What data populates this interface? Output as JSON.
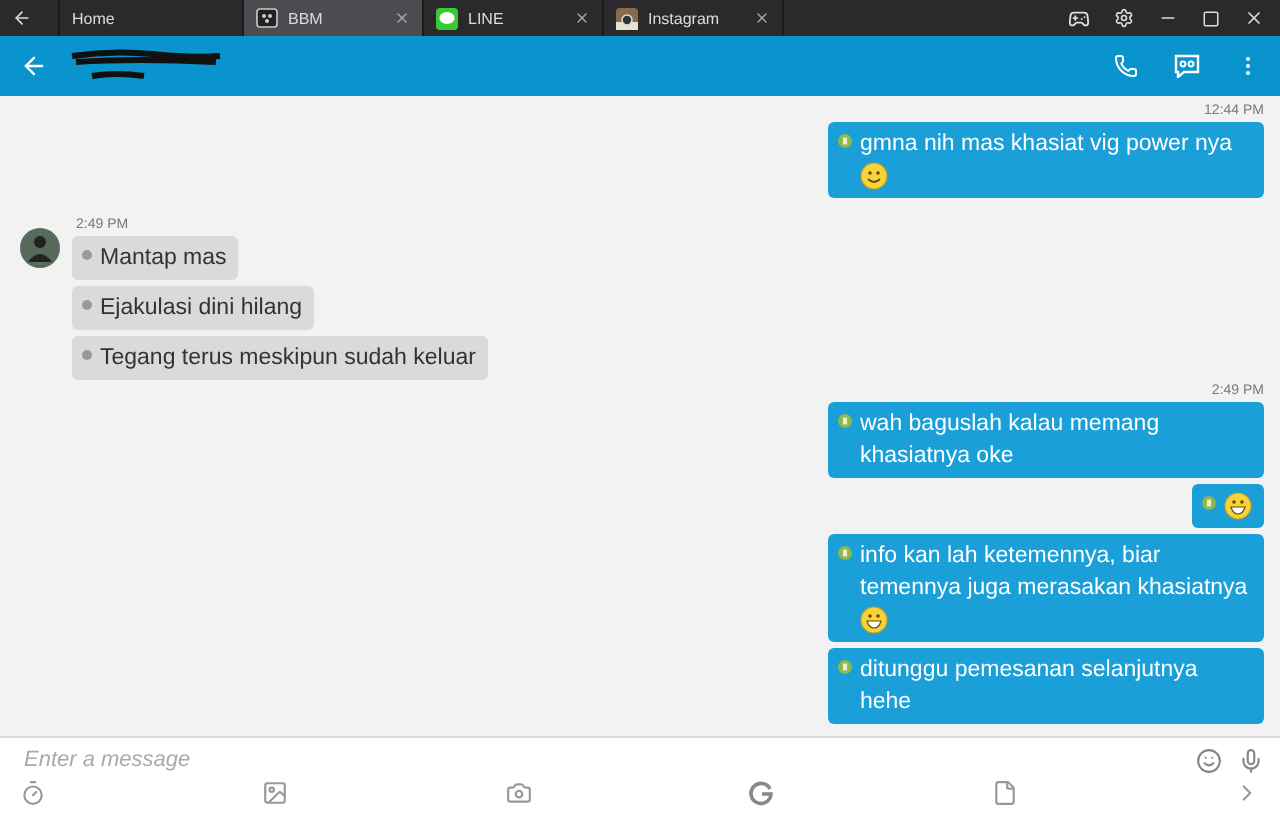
{
  "tabs": [
    {
      "label": "Home",
      "kind": "plain",
      "selected": false
    },
    {
      "label": "BBM",
      "kind": "bbm",
      "selected": true
    },
    {
      "label": "LINE",
      "kind": "line",
      "selected": false
    },
    {
      "label": "Instagram",
      "kind": "instagram",
      "selected": false
    }
  ],
  "groups": [
    {
      "kind": "outgoing",
      "time": "12:44 PM",
      "messages": [
        {
          "kind": "smile",
          "text": "gmna nih mas khasiat vig power nya"
        }
      ]
    },
    {
      "kind": "incoming",
      "time": "2:49 PM",
      "messages": [
        {
          "kind": "plain",
          "text": "Mantap mas"
        },
        {
          "kind": "plain",
          "text": "Ejakulasi dini hilang"
        },
        {
          "kind": "plain",
          "text": "Tegang terus meskipun sudah keluar"
        }
      ]
    },
    {
      "kind": "outgoing",
      "time": "2:49 PM",
      "messages": [
        {
          "kind": "plain",
          "text": "wah baguslah kalau memang khasiatnya oke"
        },
        {
          "kind": "grin"
        },
        {
          "kind": "grin",
          "text": "info kan lah ketemennya, biar temennya juga merasakan khasiatnya"
        },
        {
          "kind": "plain",
          "text": "ditunggu pemesanan selanjutnya hehe"
        }
      ]
    }
  ],
  "composer": {
    "placeholder": "Enter a message"
  }
}
